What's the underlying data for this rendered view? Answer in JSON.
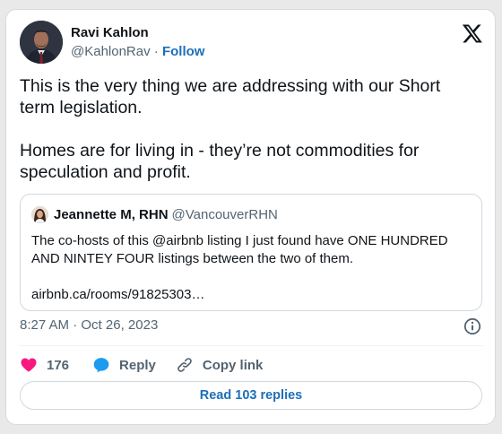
{
  "author": {
    "name": "Ravi Kahlon",
    "handle": "@KahlonRav",
    "separator": "·",
    "follow_label": "Follow"
  },
  "tweet": {
    "text": "This is the very thing we are addressing with our Short term legislation.\n\nHomes are for living in - they’re not commodities for speculation and profit."
  },
  "quoted": {
    "name": "Jeannette M, RHN",
    "handle": "@VancouverRHN",
    "text": "The co-hosts of this @airbnb listing I just found have ONE HUNDRED AND NINTEY FOUR listings between the two of them.\n\nairbnb.ca/rooms/91825303…"
  },
  "meta": {
    "time": "8:27 AM",
    "separator": "·",
    "date": "Oct 26, 2023"
  },
  "actions": {
    "like_count": "176",
    "reply_label": "Reply",
    "copy_label": "Copy link"
  },
  "read_replies_label": "Read 103 replies",
  "icons": {
    "brand": "x-logo-icon",
    "info": "info-icon",
    "like": "heart-icon",
    "reply": "reply-bubble-icon",
    "copy": "link-icon"
  },
  "colors": {
    "like": "#f91880",
    "reply": "#1d9bf0",
    "link": "#1d6fb8",
    "muted": "#536471",
    "text": "#0f1419"
  }
}
